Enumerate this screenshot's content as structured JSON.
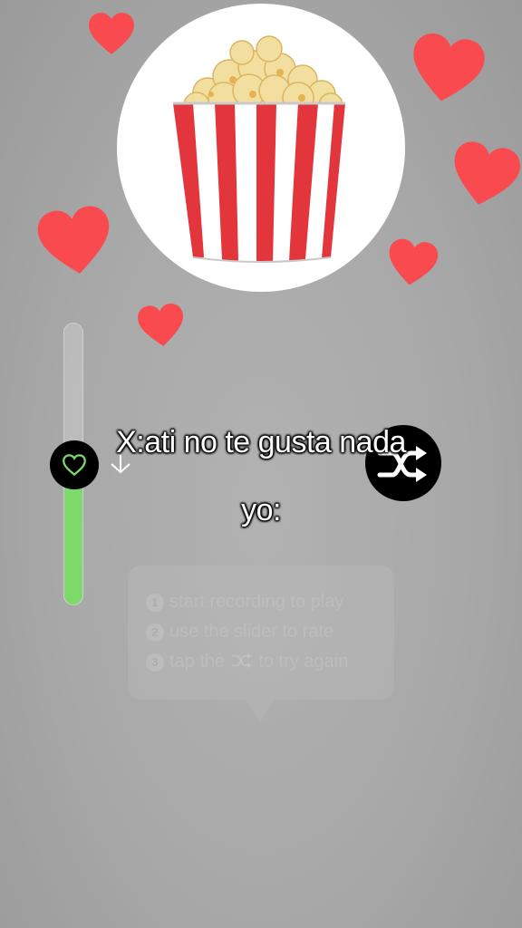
{
  "caption": {
    "line1": "X:ati no te gusta nada",
    "line2": "yo:"
  },
  "rating_slider": {
    "level_fraction": 0.45,
    "thumb_icon": "heart-outline-icon",
    "fill_color": "#7dd96a"
  },
  "shuffle_button": {
    "icon": "shuffle-icon"
  },
  "tooltip": {
    "steps": [
      {
        "number": "1",
        "text": "start recording to play"
      },
      {
        "number": "2",
        "text": "use the slider to rate"
      },
      {
        "number": "3",
        "text_before": "tap the",
        "icon": "shuffle-icon",
        "text_after": "to try again"
      }
    ]
  },
  "filter_image": {
    "icon": "popcorn-icon"
  },
  "colors": {
    "heart": "#f84a4f",
    "background": "#a9a9a9",
    "accent_green": "#7dd96a"
  }
}
